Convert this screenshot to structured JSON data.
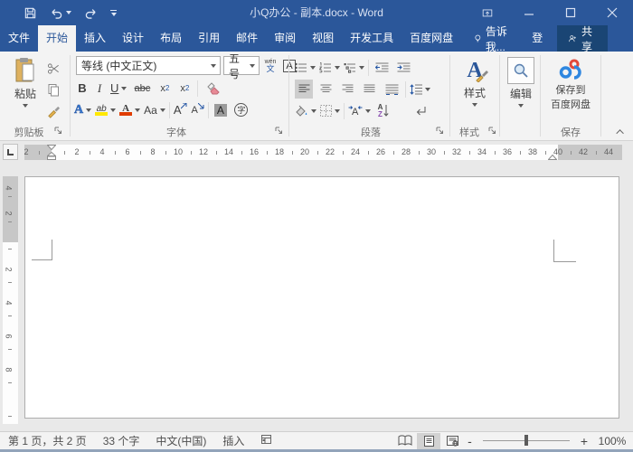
{
  "colors": {
    "accent": "#2b579a",
    "share_bg": "#1a4574",
    "highlight_yellow": "#ffe800",
    "font_red": "#e03c00",
    "baidu_red": "#e2493b",
    "baidu_blue": "#2f87e0"
  },
  "titlebar": {
    "title": "小Q办公 - 副本.docx - Word"
  },
  "menubar": {
    "tabs": [
      {
        "label": "文件"
      },
      {
        "label": "开始"
      },
      {
        "label": "插入"
      },
      {
        "label": "设计"
      },
      {
        "label": "布局"
      },
      {
        "label": "引用"
      },
      {
        "label": "邮件"
      },
      {
        "label": "审阅"
      },
      {
        "label": "视图"
      },
      {
        "label": "开发工具"
      },
      {
        "label": "百度网盘"
      }
    ],
    "tell_me": "告诉我...",
    "login": "登录",
    "share": "共享"
  },
  "ribbon": {
    "clipboard": {
      "group_label": "剪贴板",
      "paste_label": "粘贴"
    },
    "font": {
      "group_label": "字体",
      "font_name": "等线 (中文正文)",
      "font_size": "五号",
      "phonetic_top": "wén",
      "phonetic_bottom": "文",
      "char_border": "A",
      "bold": "B",
      "italic": "I",
      "underline": "U",
      "strikethrough": "abc",
      "subscript_base": "x",
      "subscript_small": "2",
      "superscript_base": "x",
      "superscript_small": "2",
      "text_effects": "A",
      "highlight": "ab",
      "font_color": "A",
      "change_case": "Aa",
      "grow": "A",
      "shrink": "A",
      "char_shading": "A",
      "enclose": "字"
    },
    "paragraph": {
      "group_label": "段落",
      "sort_a": "A",
      "sort_z": "Z"
    },
    "styles": {
      "group_label": "样式",
      "button_label": "样式",
      "icon_letter": "A"
    },
    "editing": {
      "button_label": "编辑"
    },
    "save": {
      "group_label": "保存",
      "button_line1": "保存到",
      "button_line2": "百度网盘"
    }
  },
  "ruler": {
    "h_numbers": [
      "2",
      "2",
      "4",
      "6",
      "8",
      "10",
      "12",
      "14",
      "16",
      "18",
      "20",
      "22",
      "24",
      "26",
      "28",
      "30",
      "32",
      "34",
      "36",
      "38",
      "40",
      "42",
      "44"
    ],
    "v_margin_numbers": [
      "4",
      "2"
    ],
    "v_numbers": [
      "2",
      "4",
      "6",
      "8"
    ]
  },
  "statusbar": {
    "page_info": "第 1 页，共 2 页",
    "word_count": "33 个字",
    "language": "中文(中国)",
    "insert_mode": "插入",
    "zoom_minus": "-",
    "zoom_plus": "+",
    "zoom_level": "100%"
  }
}
